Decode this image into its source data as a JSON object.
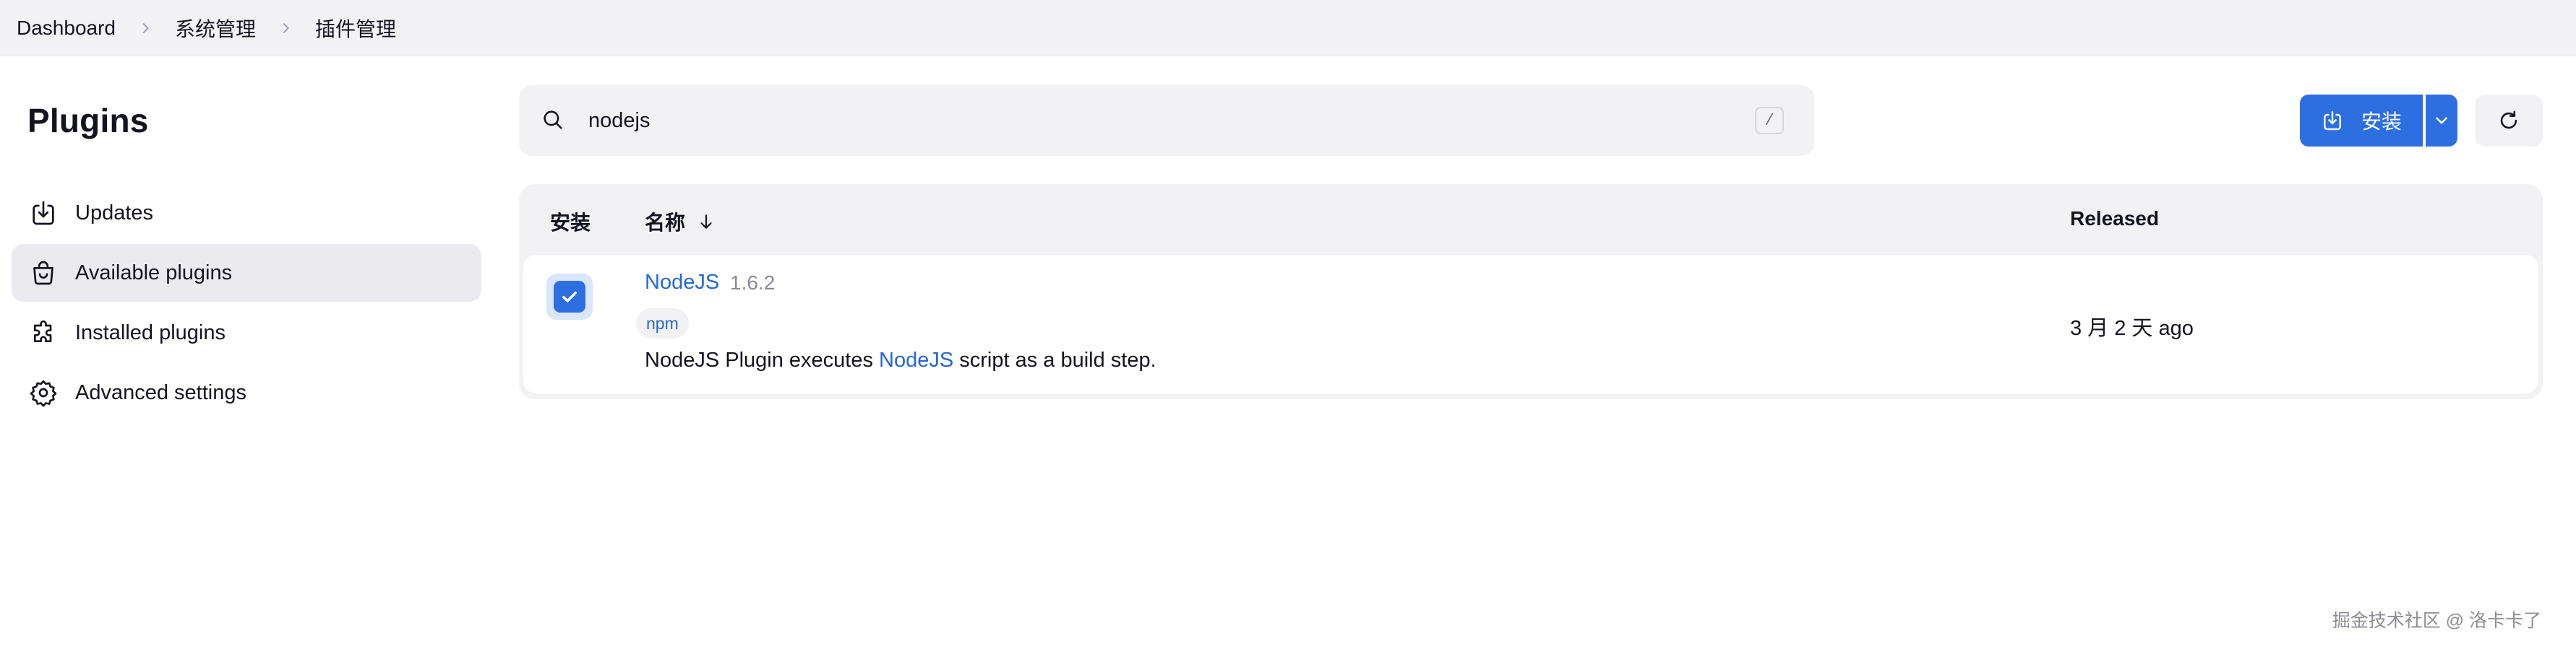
{
  "breadcrumb": [
    "Dashboard",
    "系统管理",
    "插件管理"
  ],
  "sidebar": {
    "title": "Plugins",
    "items": [
      {
        "label": "Updates",
        "icon": "download-icon",
        "active": false
      },
      {
        "label": "Available plugins",
        "icon": "shopping-bag-icon",
        "active": true
      },
      {
        "label": "Installed plugins",
        "icon": "puzzle-icon",
        "active": false
      },
      {
        "label": "Advanced settings",
        "icon": "gear-icon",
        "active": false
      }
    ]
  },
  "search": {
    "value": "nodejs",
    "shortcut": "/"
  },
  "toolbar": {
    "install_label": "安装"
  },
  "table": {
    "headers": {
      "install": "安装",
      "name": "名称",
      "released": "Released"
    },
    "rows": [
      {
        "checked": true,
        "name": "NodeJS",
        "version": "1.6.2",
        "tag": "npm",
        "desc_prefix": "NodeJS Plugin executes ",
        "desc_link": "NodeJS",
        "desc_suffix": " script as a build step.",
        "released": "3 月 2 天 ago"
      }
    ]
  },
  "watermark": "掘金技术社区 @ 洛卡卡了",
  "colors": {
    "accent": "#2d6fe0",
    "link": "#2467d6",
    "background": "#ffffff",
    "panel": "#f2f2f5"
  }
}
